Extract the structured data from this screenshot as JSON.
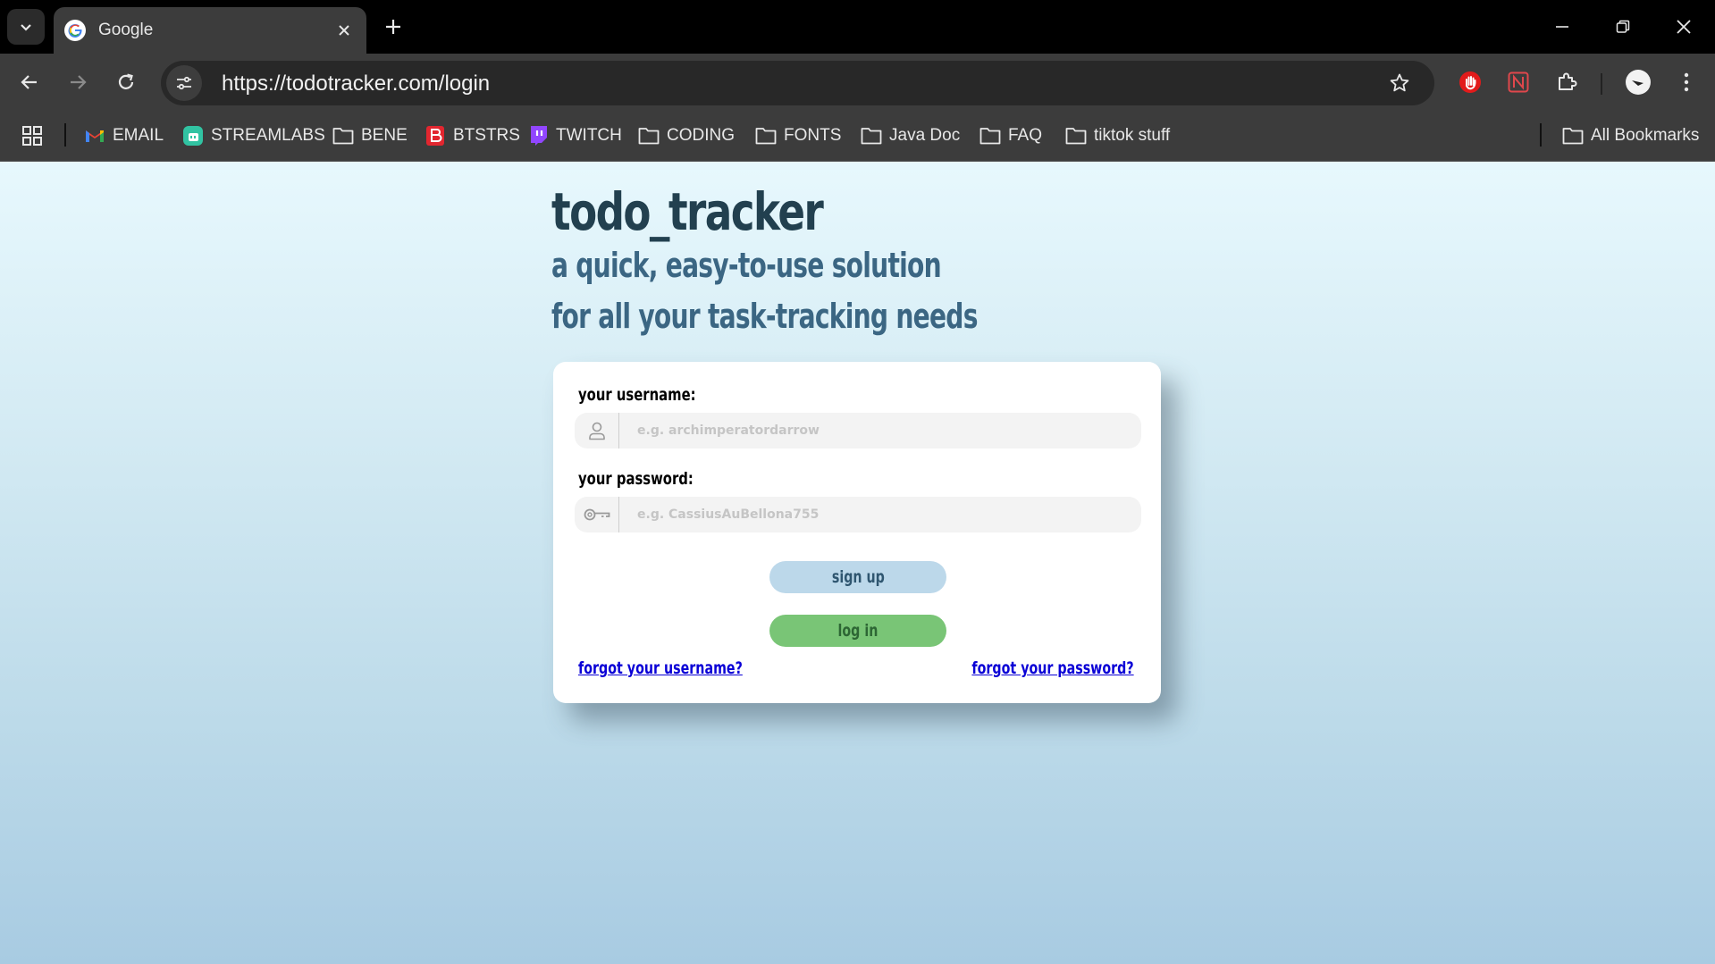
{
  "browser": {
    "tab": {
      "title": "Google",
      "favicon": "google-icon"
    },
    "url": "https://todotracker.com/login",
    "accent_ext_color": "#e21b1b",
    "bookmarks": [
      {
        "label": "EMAIL",
        "icon": "gmail-icon"
      },
      {
        "label": "STREAMLABS",
        "icon": "streamlabs-icon"
      },
      {
        "label": "BENE",
        "icon": "folder-icon"
      },
      {
        "label": "BTSTRS",
        "icon": "btstrs-icon"
      },
      {
        "label": "TWITCH",
        "icon": "twitch-icon"
      },
      {
        "label": "CODING",
        "icon": "folder-icon"
      },
      {
        "label": "FONTS",
        "icon": "folder-icon"
      },
      {
        "label": "Java Doc",
        "icon": "folder-icon"
      },
      {
        "label": "FAQ",
        "icon": "folder-icon"
      },
      {
        "label": "tiktok stuff",
        "icon": "folder-icon"
      }
    ],
    "all_bookmarks_label": "All Bookmarks"
  },
  "hero": {
    "title": "todo_tracker",
    "subtitle_line1": "a quick, easy-to-use solution",
    "subtitle_line2": "for all your task-tracking needs"
  },
  "login_form": {
    "username_label": "your username:",
    "username_placeholder": "e.g. archimperatordarrow",
    "password_label": "your password:",
    "password_placeholder": "e.g. CassiusAuBellona755",
    "signup_label": "sign up",
    "login_label": "log in",
    "forgot_username": "forgot your username?",
    "forgot_password": "forgot your password?"
  },
  "colors": {
    "title": "#22404f",
    "subtitle": "#3b6683",
    "signup_bg": "#bcd8ea",
    "login_bg": "#79c576",
    "link": "#0a00d6"
  }
}
